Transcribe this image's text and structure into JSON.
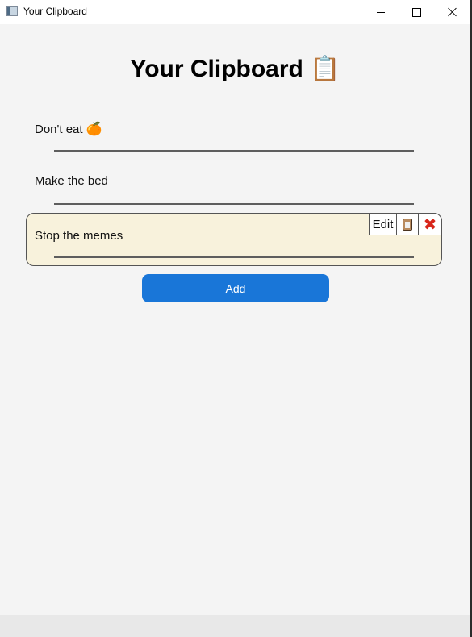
{
  "window": {
    "title": "Your Clipboard",
    "app_icon": "window-app-icon",
    "controls": [
      "minimize",
      "maximize",
      "close"
    ]
  },
  "heading": {
    "text": "Your Clipboard",
    "emoji": "📋"
  },
  "items": [
    {
      "text": "Don't eat",
      "emoji": "🍊",
      "selected": false
    },
    {
      "text": "Make the bed",
      "emoji": "",
      "selected": false
    },
    {
      "text": "Stop the memes",
      "emoji": "",
      "selected": true
    }
  ],
  "item_actions": {
    "edit_label": "Edit",
    "copy_icon": "clipboard-icon",
    "delete_glyph": "✖"
  },
  "add_button": {
    "label": "Add"
  },
  "colors": {
    "accent": "#1976d8",
    "selected_bg": "#f8f2dc",
    "delete": "#d8261b",
    "background": "#f4f4f4"
  }
}
